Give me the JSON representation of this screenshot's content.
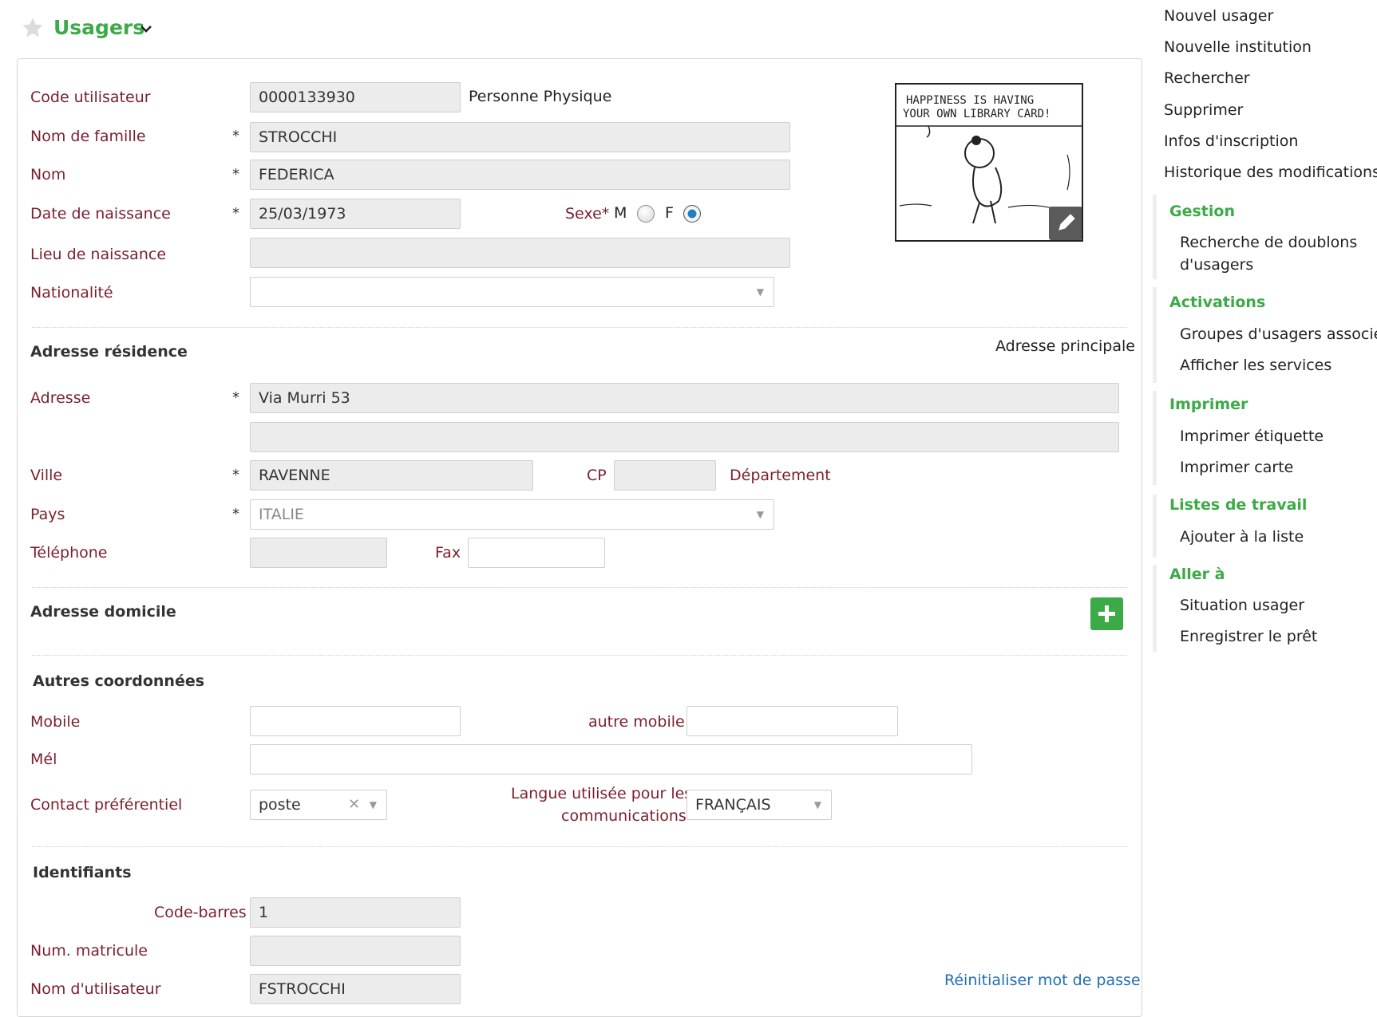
{
  "header": {
    "title": "Usagers"
  },
  "identity": {
    "code_label": "Code utilisateur",
    "code_value": "0000133930",
    "person_type": "Personne Physique",
    "surname_label": "Nom de famille",
    "surname_value": "STROCCHI",
    "name_label": "Nom",
    "name_value": "FEDERICA",
    "dob_label": "Date de naissance",
    "dob_value": "25/03/1973",
    "sex_label": "Sexe*",
    "sex_m": "M",
    "sex_f": "F",
    "sex_selected": "F",
    "birthplace_label": "Lieu de naissance",
    "birthplace_value": "",
    "nationality_label": "Nationalité",
    "nationality_value": "",
    "photo_caption_line1": "HAPPINESS IS HAVING",
    "photo_caption_line2": "YOUR OWN LIBRARY CARD!"
  },
  "residence": {
    "title": "Adresse résidence",
    "main_tag": "Adresse principale",
    "address_label": "Adresse",
    "address_value": "Via Murri 53",
    "address2_value": "",
    "city_label": "Ville",
    "city_value": "RAVENNE",
    "cp_label": "CP",
    "cp_value": "",
    "dept_label": "Département",
    "country_label": "Pays",
    "country_value": "ITALIE",
    "phone_label": "Téléphone",
    "phone_value": "",
    "fax_label": "Fax",
    "fax_value": ""
  },
  "domicile": {
    "title": "Adresse domicile"
  },
  "other": {
    "title": "Autres coordonnées",
    "mobile_label": "Mobile",
    "mobile_value": "",
    "other_mobile_label": "autre mobile",
    "other_mobile_value": "",
    "email_label": "Mél",
    "email_value": "",
    "contact_label": "Contact préférentiel",
    "contact_value": "poste",
    "language_label_line1": "Langue utilisée pour les",
    "language_label_line2": "communications",
    "language_value": "FRANÇAIS"
  },
  "ids": {
    "title": "Identifiants",
    "barcode_label": "Code-barres",
    "barcode_value": "1",
    "matricule_label": "Num. matricule",
    "matricule_value": "",
    "username_label": "Nom d'utilisateur",
    "username_value": "FSTROCCHI",
    "reset_link": "Réinitialiser mot de passe"
  },
  "sidebar": {
    "top": [
      "Nouvel usager",
      "Nouvelle institution",
      "Rechercher",
      "Supprimer",
      "Infos d'inscription",
      "Historique des modifications"
    ],
    "gestion": {
      "title": "Gestion",
      "items": [
        "Recherche de doublons",
        "d'usagers"
      ]
    },
    "activations": {
      "title": "Activations",
      "items": [
        "Groupes d'usagers associés",
        "Afficher les services"
      ]
    },
    "imprimer": {
      "title": "Imprimer",
      "items": [
        "Imprimer étiquette",
        "Imprimer carte"
      ]
    },
    "listes": {
      "title": "Listes de travail",
      "items": [
        "Ajouter à la liste"
      ]
    },
    "aller": {
      "title": "Aller à",
      "items": [
        "Situation usager",
        "Enregistrer le prêt"
      ]
    }
  },
  "colors": {
    "label": "#7a1f2e",
    "accent": "#3cab47",
    "link": "#1f6fb5"
  }
}
